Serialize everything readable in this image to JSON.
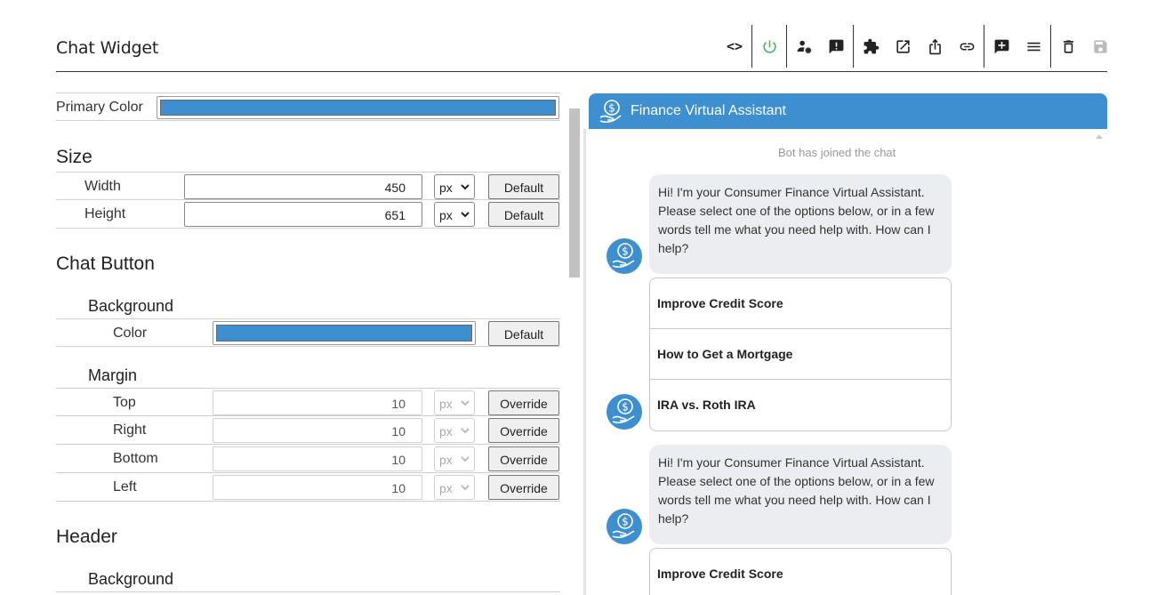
{
  "page": {
    "title": "Chat Widget"
  },
  "toolbar": {
    "items": [
      {
        "icon": "code-icon",
        "glyph": "<>"
      },
      {
        "icon": "power-icon"
      },
      {
        "icon": "users-settings-icon"
      },
      {
        "icon": "chat-alert-icon"
      },
      {
        "icon": "puzzle-icon"
      },
      {
        "icon": "open-external-icon"
      },
      {
        "icon": "share-icon"
      },
      {
        "icon": "link-icon"
      },
      {
        "icon": "add-comment-icon"
      },
      {
        "icon": "menu-icon"
      },
      {
        "icon": "trash-icon"
      },
      {
        "icon": "save-icon",
        "disabled": true
      }
    ]
  },
  "settings": {
    "primary_color": {
      "label": "Primary Color",
      "value": "#3d8fcf"
    },
    "size": {
      "heading": "Size",
      "width": {
        "label": "Width",
        "value": "450",
        "unit": "px",
        "button": "Default"
      },
      "height": {
        "label": "Height",
        "value": "651",
        "unit": "px",
        "button": "Default"
      }
    },
    "chat_button": {
      "heading": "Chat Button",
      "background": {
        "heading": "Background",
        "color": {
          "label": "Color",
          "value": "#3d8fcf",
          "button": "Default"
        }
      },
      "margin": {
        "heading": "Margin",
        "top": {
          "label": "Top",
          "value": "10",
          "unit": "px",
          "button": "Override"
        },
        "right": {
          "label": "Right",
          "value": "10",
          "unit": "px",
          "button": "Override"
        },
        "bottom": {
          "label": "Bottom",
          "value": "10",
          "unit": "px",
          "button": "Override"
        },
        "left": {
          "label": "Left",
          "value": "10",
          "unit": "px",
          "button": "Override"
        }
      }
    },
    "header": {
      "heading": "Header",
      "background": {
        "heading": "Background"
      }
    }
  },
  "chat": {
    "title": "Finance Virtual Assistant",
    "header_color": "#3d8fcf",
    "joined": "Bot has joined the chat",
    "messages": [
      {
        "text": "Hi! I'm your Consumer Finance Virtual Assistant. Please select one of the options below, or in a few words tell me what you need help with. How can I help?",
        "options": [
          "Improve Credit Score",
          "How to Get a Mortgage",
          "IRA vs. Roth IRA"
        ]
      },
      {
        "text": "Hi! I'm your Consumer Finance Virtual Assistant. Please select one of the options below, or in a few words tell me what you need help with. How can I help?",
        "options": [
          "Improve Credit Score"
        ]
      }
    ]
  }
}
